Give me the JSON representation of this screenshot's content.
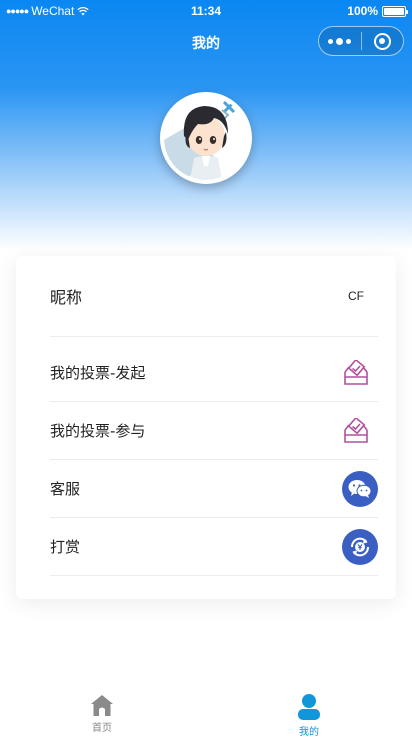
{
  "status_bar": {
    "carrier": "WeChat",
    "time": "11:34",
    "battery": "100%"
  },
  "nav": {
    "title": "我的"
  },
  "profile": {
    "nickname_label": "昵称",
    "nickname_value": "CF"
  },
  "menu": [
    {
      "label": "我的投票-发起",
      "icon": "vote-box-icon"
    },
    {
      "label": "我的投票-参与",
      "icon": "vote-box-icon"
    },
    {
      "label": "客服",
      "icon": "wechat-chat-icon"
    },
    {
      "label": "打赏",
      "icon": "reward-money-icon"
    }
  ],
  "tabbar": {
    "items": [
      {
        "label": "首页",
        "icon": "home-icon",
        "active": false
      },
      {
        "label": "我的",
        "icon": "user-icon",
        "active": true
      }
    ]
  },
  "colors": {
    "header_blue": "#0a87f2",
    "tab_active": "#1296db",
    "vote_icon": "#b0519f",
    "round_icon_bg": "#3a5ec2"
  }
}
